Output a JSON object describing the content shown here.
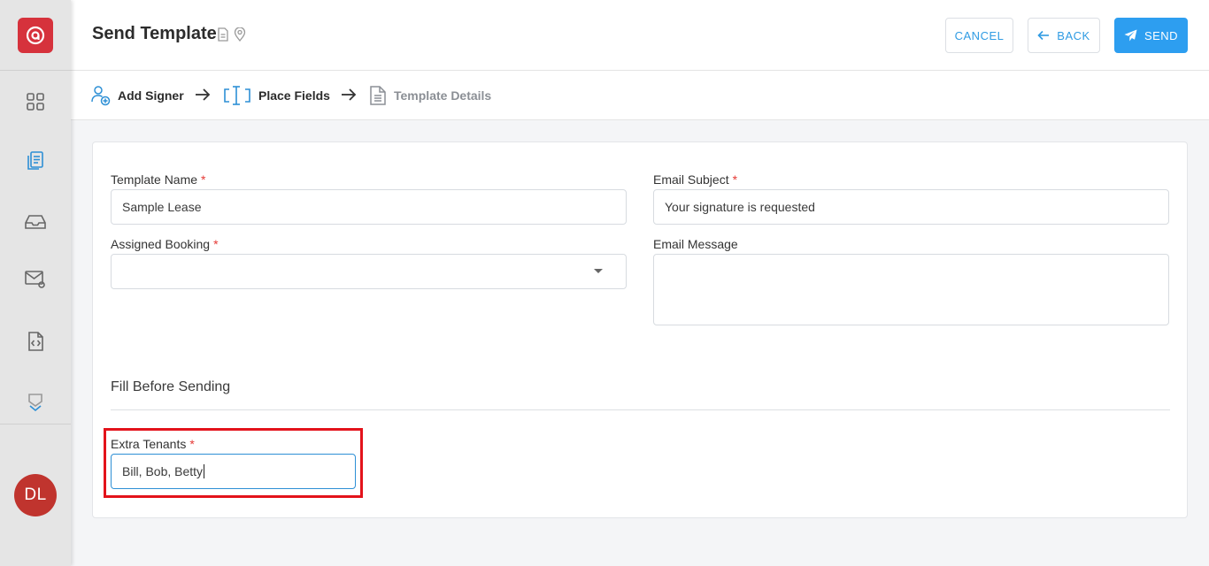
{
  "header": {
    "title": "Send Template",
    "cancel_label": "CANCEL",
    "back_label": "BACK",
    "send_label": "SEND"
  },
  "sidebar": {
    "avatar_initials": "DL",
    "items": [
      {
        "icon": "grid-icon"
      },
      {
        "icon": "documents-icon"
      },
      {
        "icon": "inbox-icon"
      },
      {
        "icon": "mail-settings-icon"
      },
      {
        "icon": "code-file-icon"
      },
      {
        "icon": "chevron-down-icon"
      }
    ]
  },
  "steps": [
    {
      "label": "Add Signer",
      "icon": "add-user-icon"
    },
    {
      "label": "Place Fields",
      "icon": "text-field-icon"
    },
    {
      "label": "Template Details",
      "icon": "document-icon"
    }
  ],
  "form": {
    "template_name": {
      "label": "Template Name",
      "required": "*",
      "value": "Sample Lease"
    },
    "email_subject": {
      "label": "Email Subject",
      "required": "*",
      "value": "Your signature is requested"
    },
    "assigned_booking": {
      "label": "Assigned Booking",
      "required": "*",
      "value": ""
    },
    "email_message": {
      "label": "Email Message",
      "value": ""
    },
    "section_title": "Fill Before Sending",
    "extra_tenants": {
      "label": "Extra Tenants",
      "required": "*",
      "value": "Bill, Bob, Betty"
    }
  },
  "colors": {
    "accent": "#2d9ef0",
    "brand": "#d6323c",
    "required": "#e53935",
    "highlight": "#e3131b"
  }
}
